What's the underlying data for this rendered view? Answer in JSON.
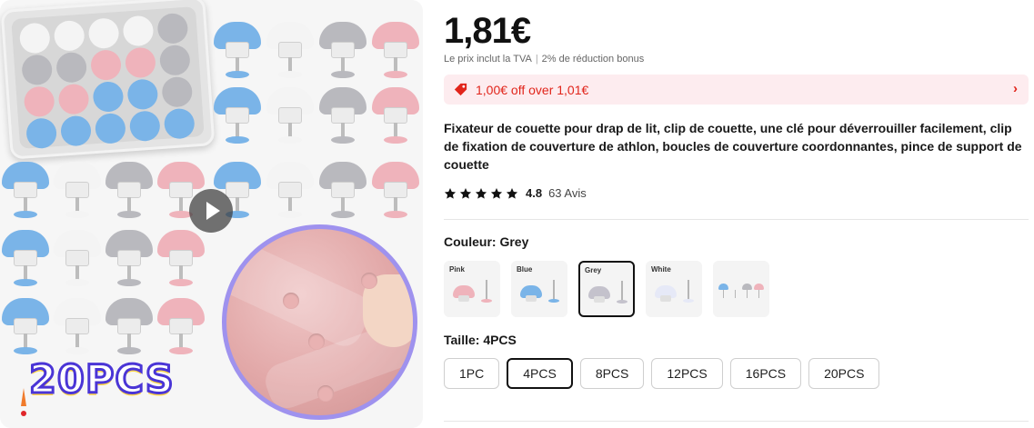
{
  "image": {
    "badge_text": "20PCS",
    "play_icon": "play-icon",
    "colors": {
      "blue": "#7ab4e8",
      "white": "#f4f4f4",
      "grey": "#b9b9be",
      "pink": "#efb3bb",
      "border": "#9f92ee"
    }
  },
  "product": {
    "price": "1,81€",
    "vat_note": "Le prix inclut la TVA",
    "bonus_note": "2% de réduction bonus",
    "coupon": {
      "text": "1,00€ off over 1,01€",
      "icon": "tag-icon",
      "arrow": "›",
      "color": "#e1251b"
    },
    "title": "Fixateur de couette pour drap de lit, clip de couette, une clé pour déverrouiller facilement, clip de fixation de couverture de athlon, boucles de couverture coordonnantes, pince de support de couette",
    "rating": {
      "score": "4.8",
      "count": "63 Avis",
      "stars": 5
    }
  },
  "color_option": {
    "label": "Couleur: ",
    "selected": "Grey",
    "swatches": [
      {
        "name": "Pink",
        "color": "#efb3bb"
      },
      {
        "name": "Blue",
        "color": "#7ab4e8"
      },
      {
        "name": "Grey",
        "color": "#c4c2cc"
      },
      {
        "name": "White",
        "color": "#e6e9f7"
      },
      {
        "name": "",
        "color": "#7ab4e8"
      }
    ]
  },
  "size_option": {
    "label": "Taille: ",
    "selected": "4PCS",
    "options": [
      "1PC",
      "4PCS",
      "8PCS",
      "12PCS",
      "16PCS",
      "20PCS"
    ]
  }
}
